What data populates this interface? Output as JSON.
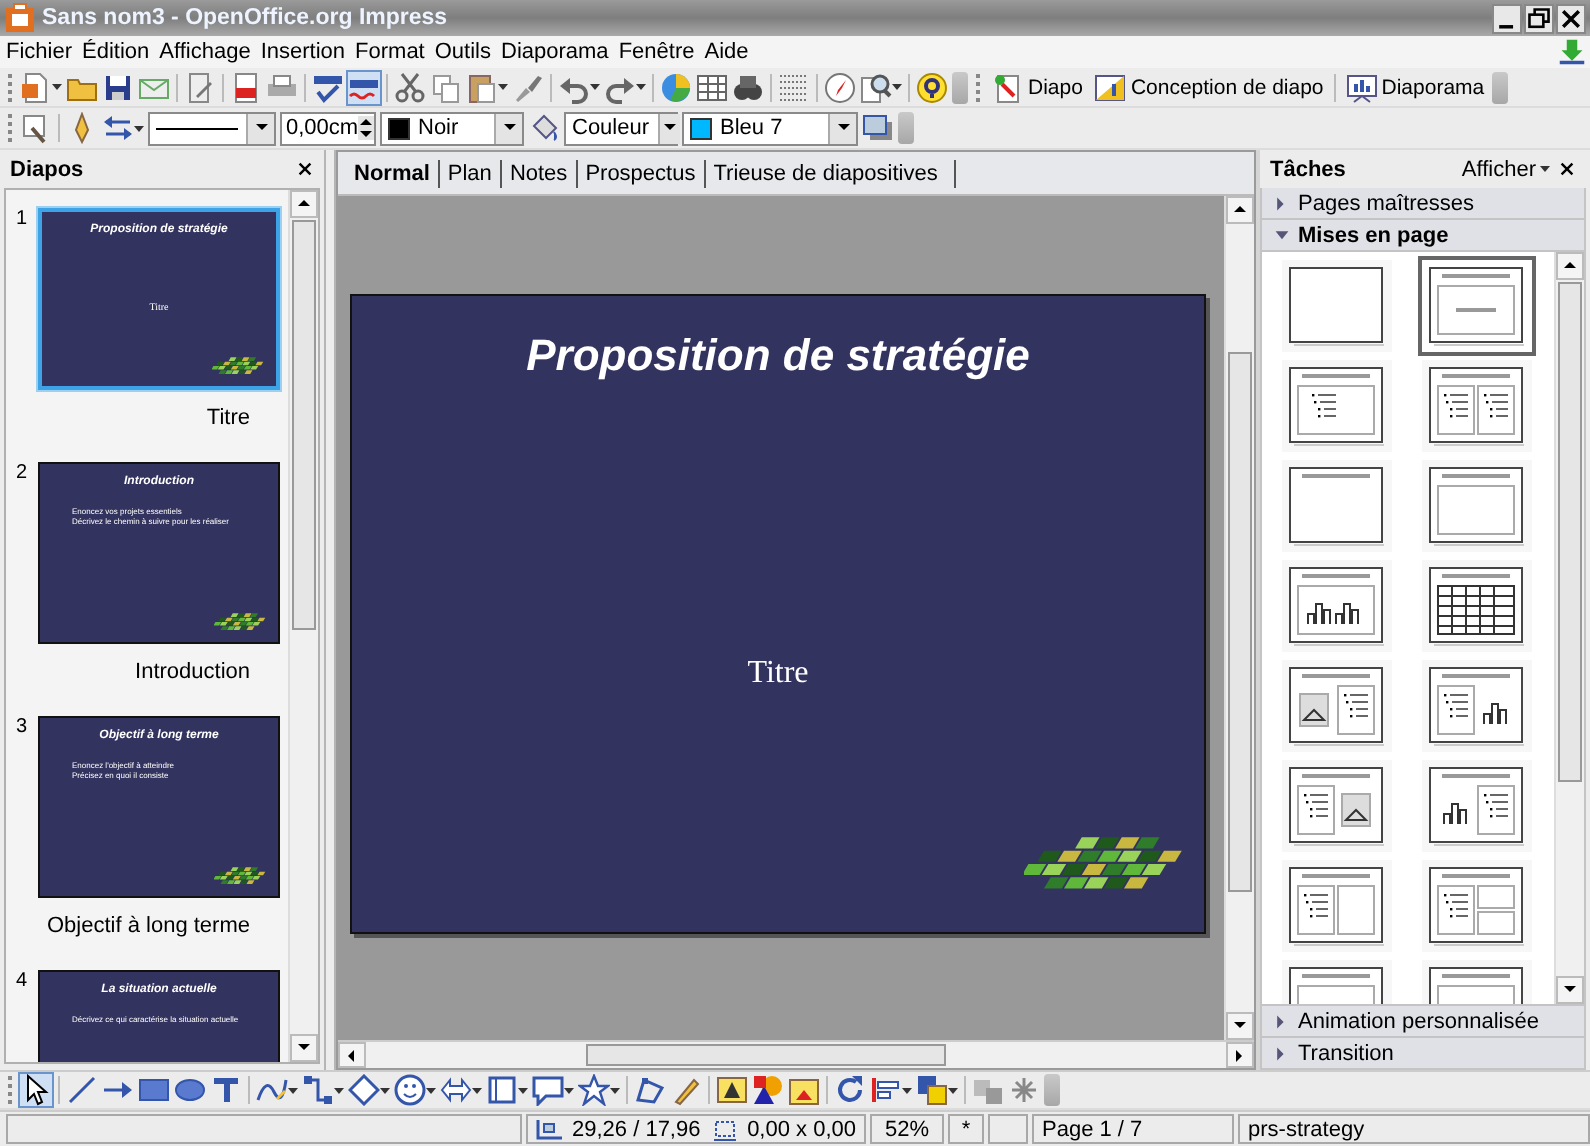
{
  "window": {
    "title": "Sans nom3 - OpenOffice.org Impress"
  },
  "menu": [
    {
      "label": "Fichier"
    },
    {
      "label": "Édition"
    },
    {
      "label": "Affichage"
    },
    {
      "label": "Insertion"
    },
    {
      "label": "Format"
    },
    {
      "label": "Outils"
    },
    {
      "label": "Diaporama"
    },
    {
      "label": "Fenêtre"
    },
    {
      "label": "Aide"
    }
  ],
  "standard_toolbar": {
    "auto_spellcheck": {
      "on": true
    },
    "buttons": [
      {
        "label": "Diapo"
      },
      {
        "label": "Conception de diapo"
      },
      {
        "label": "Diaporama"
      }
    ]
  },
  "line_toolbar": {
    "line_width": "0,00cm",
    "line_color": "Noir",
    "area_style": "Couleur",
    "area_color": "Bleu 7"
  },
  "slides_panel": {
    "title": "Diapos",
    "slides": [
      {
        "number": "1",
        "title": "Proposition de stratégie",
        "subtitle": "Titre",
        "label": "Titre",
        "selected": true
      },
      {
        "number": "2",
        "title": "Introduction",
        "bullets": [
          "Enoncez vos projets essentiels",
          "Décrivez le chemin à suivre pour les réaliser"
        ],
        "label": "Introduction",
        "selected": false
      },
      {
        "number": "3",
        "title": "Objectif à long terme",
        "bullets": [
          "Enoncez l'objectif à atteindre",
          "Précisez en quoi il consiste"
        ],
        "label": "Objectif à long terme",
        "selected": false
      },
      {
        "number": "4",
        "title": "La situation actuelle",
        "bullets": [
          "Décrivez ce qui caractérise la situation actuelle"
        ],
        "selected": false
      }
    ]
  },
  "editor": {
    "tabs": [
      {
        "label": "Normal",
        "selected": true
      },
      {
        "label": "Plan",
        "selected": false
      },
      {
        "label": "Notes",
        "selected": false
      },
      {
        "label": "Prospectus",
        "selected": false
      },
      {
        "label": "Trieuse de diapositives",
        "selected": false
      }
    ],
    "slide": {
      "title": "Proposition de stratégie",
      "subtitle": "Titre"
    }
  },
  "tasks_panel": {
    "title": "Tâches",
    "view_menu": "Afficher",
    "sections": [
      {
        "label": "Pages maîtresses",
        "expanded": false
      },
      {
        "label": "Mises en page",
        "expanded": true,
        "layouts": [
          {
            "kind": "blank",
            "selected": false
          },
          {
            "kind": "title-content",
            "selected": true
          },
          {
            "kind": "title-list",
            "selected": false
          },
          {
            "kind": "title-2list",
            "selected": false
          },
          {
            "kind": "title-only",
            "selected": false
          },
          {
            "kind": "title-box",
            "selected": false
          },
          {
            "kind": "title-chart",
            "selected": false
          },
          {
            "kind": "title-table",
            "selected": false
          },
          {
            "kind": "picture-list",
            "selected": false
          },
          {
            "kind": "list-chart",
            "selected": false
          },
          {
            "kind": "list-picture",
            "selected": false
          },
          {
            "kind": "chart-list",
            "selected": false
          },
          {
            "kind": "list-box",
            "selected": false
          },
          {
            "kind": "list-2box",
            "selected": false
          },
          {
            "kind": "title-box",
            "selected": false
          },
          {
            "kind": "title-box",
            "selected": false
          }
        ]
      },
      {
        "label": "Animation personnalisée",
        "expanded": false
      },
      {
        "label": "Transition",
        "expanded": false
      }
    ]
  },
  "drawing_toolbar": {
    "select_tool": {
      "selected": true
    }
  },
  "status_bar": {
    "position": "29,26 / 17,96",
    "size": "0,00 x 0,00",
    "zoom": "52%",
    "modified": "*",
    "page": "Page 1 / 7",
    "design": "prs-strategy"
  }
}
